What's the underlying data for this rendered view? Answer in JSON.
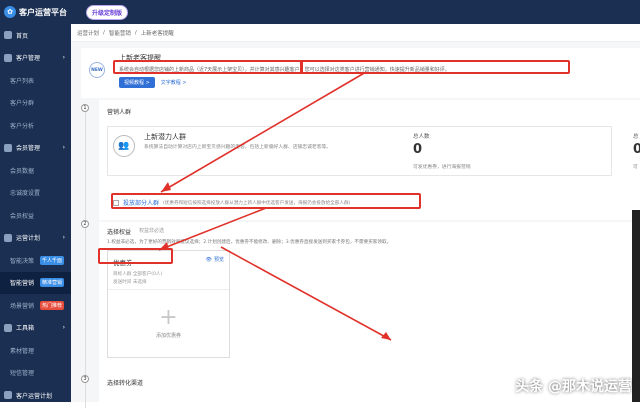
{
  "app": {
    "title": "客户运营平台",
    "upgrade_label": "升级定制版"
  },
  "sidebar": {
    "items": [
      {
        "label": "首页",
        "type": "group"
      },
      {
        "label": "客户管理",
        "type": "group",
        "chevron": "›"
      },
      {
        "label": "客户列表",
        "type": "sub"
      },
      {
        "label": "客户分群",
        "type": "sub"
      },
      {
        "label": "客户分析",
        "type": "sub"
      },
      {
        "label": "会员管理",
        "type": "group",
        "chevron": "›"
      },
      {
        "label": "会员数据",
        "type": "sub"
      },
      {
        "label": "忠诚度设置",
        "type": "sub"
      },
      {
        "label": "会员权益",
        "type": "sub"
      },
      {
        "label": "运营计划",
        "type": "group",
        "chevron": "›"
      },
      {
        "label": "智能决策",
        "type": "sub",
        "badge": "千人千面"
      },
      {
        "label": "智能营销",
        "type": "sub",
        "badge": "精准营销",
        "active": true
      },
      {
        "label": "场景营销",
        "type": "sub",
        "badge": "热门推荐",
        "badge_hot": true
      },
      {
        "label": "工具箱",
        "type": "group",
        "chevron": "›"
      },
      {
        "label": "素材管理",
        "type": "sub"
      },
      {
        "label": "短信管理",
        "type": "sub"
      },
      {
        "label": "客户运营计划",
        "type": "group"
      }
    ]
  },
  "breadcrumb": [
    "运营计划",
    "/",
    "智能营销",
    "/",
    "上新老客提醒"
  ],
  "intro": {
    "new_label": "NEW",
    "title": "上新老客提醒",
    "desc": "系统会自动根据您店铺的上新商品（近7天展示上架宝贝），并计算对其感兴趣客户，您可以选择对这类客户进行营销通知，快速提升新品销量和好评。",
    "video_btn": "视频教程 >",
    "text_link": "文字教程 >"
  },
  "steps": [
    "1",
    "2",
    "3"
  ],
  "crowd": {
    "section_title": "营销人群",
    "group_name": "上新潜力人群",
    "group_desc": "系统算法自动计算对店内上新宝贝感兴趣的老客，包括上新偏好人群、店铺忠诚老客等。",
    "stat1_label": "总人数",
    "stat1_value": "0",
    "stat1_desc": "可发优惠券，进行海报营销",
    "stat2_label": "总",
    "stat2_value": "0",
    "stat2_desc": "可",
    "partial_link": "投放部分人群",
    "partial_desc": "(优惠券和短信按照选择投放人群从潜力上新人群中优选客户发送，海报仍会投放给全部人群)"
  },
  "rights": {
    "tab_active": "选择权益",
    "tab_inactive": "权益非必选",
    "note": "1.权益非必选，为了更好的营销效果建议选择；2.计划创建后，优惠券不能修改、删除；3.优惠券直接发送到买家卡券包，不需要买家领取。",
    "coupon_title": "优惠券",
    "preview": "预览",
    "coupon_line1": "目标人群  全部客户(0人)",
    "coupon_line2": "发送时间  未选择",
    "add_label": "添加优惠券",
    "plus": "+"
  },
  "channel": {
    "section_title": "选择转化渠道"
  },
  "watermark": "头条 @那木说运营",
  "colors": {
    "sidebar": "#1a2f52",
    "accent": "#2f6fd6",
    "highlight": "#e0322b"
  }
}
